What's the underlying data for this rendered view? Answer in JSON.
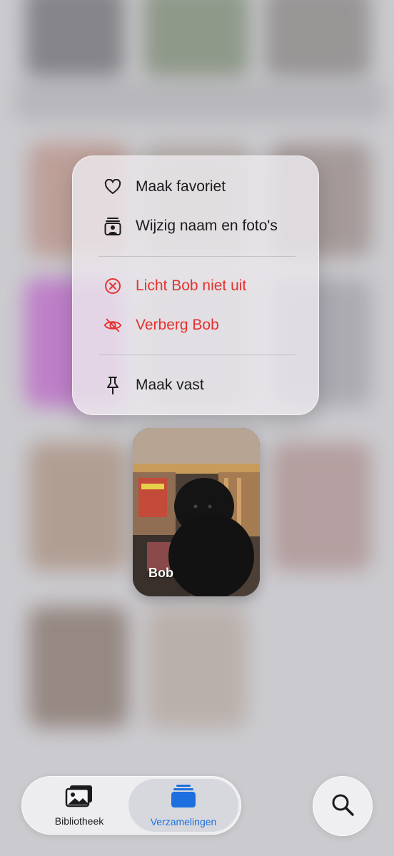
{
  "menu": {
    "items": [
      {
        "label": "Maak favoriet",
        "icon": "heart-icon"
      },
      {
        "label": "Wijzig naam en foto's",
        "icon": "person-photo-icon"
      },
      {
        "label": "Licht Bob niet uit",
        "icon": "x-circle-icon",
        "danger": true
      },
      {
        "label": "Verberg Bob",
        "icon": "eye-slash-icon",
        "danger": true
      },
      {
        "label": "Maak vast",
        "icon": "pin-icon"
      }
    ]
  },
  "card": {
    "label": "Bob"
  },
  "tabbar": {
    "tabs": [
      {
        "label": "Bibliotheek",
        "icon": "photo-library-icon"
      },
      {
        "label": "Verzamelingen",
        "icon": "collections-icon",
        "selected": true
      }
    ]
  },
  "search": {
    "icon": "search-icon"
  },
  "colors": {
    "accent": "#1d6fe0",
    "destructive": "#e5312f"
  }
}
